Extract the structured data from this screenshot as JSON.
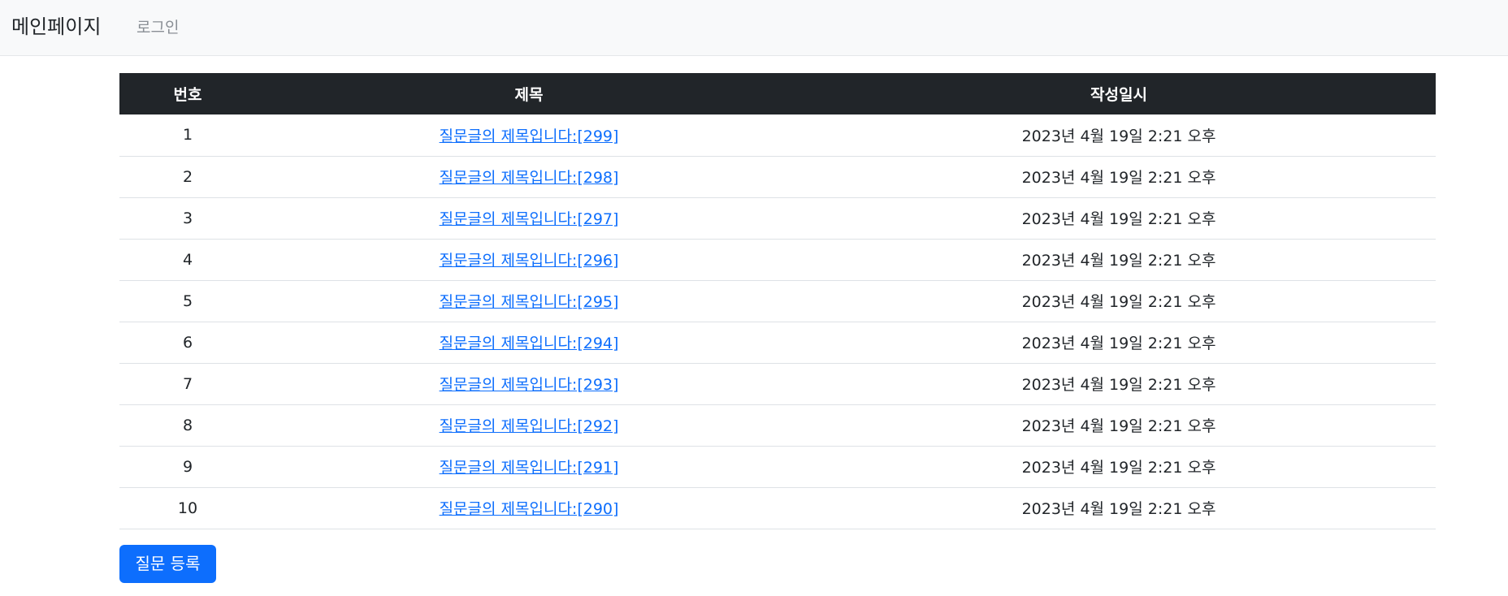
{
  "navbar": {
    "brand": "메인페이지",
    "login_link": "로그인"
  },
  "table": {
    "headers": {
      "number": "번호",
      "title": "제목",
      "created": "작성일시"
    },
    "rows": [
      {
        "number": "1",
        "title": "질문글의 제목입니다:[299]",
        "created": "2023년 4월 19일 2:21 오후"
      },
      {
        "number": "2",
        "title": "질문글의 제목입니다:[298]",
        "created": "2023년 4월 19일 2:21 오후"
      },
      {
        "number": "3",
        "title": "질문글의 제목입니다:[297]",
        "created": "2023년 4월 19일 2:21 오후"
      },
      {
        "number": "4",
        "title": "질문글의 제목입니다:[296]",
        "created": "2023년 4월 19일 2:21 오후"
      },
      {
        "number": "5",
        "title": "질문글의 제목입니다:[295]",
        "created": "2023년 4월 19일 2:21 오후"
      },
      {
        "number": "6",
        "title": "질문글의 제목입니다:[294]",
        "created": "2023년 4월 19일 2:21 오후"
      },
      {
        "number": "7",
        "title": "질문글의 제목입니다:[293]",
        "created": "2023년 4월 19일 2:21 오후"
      },
      {
        "number": "8",
        "title": "질문글의 제목입니다:[292]",
        "created": "2023년 4월 19일 2:21 오후"
      },
      {
        "number": "9",
        "title": "질문글의 제목입니다:[291]",
        "created": "2023년 4월 19일 2:21 오후"
      },
      {
        "number": "10",
        "title": "질문글의 제목입니다:[290]",
        "created": "2023년 4월 19일 2:21 오후"
      }
    ]
  },
  "actions": {
    "create_question_label": "질문 등록"
  },
  "colors": {
    "navbar_bg": "#f8f9fa",
    "table_header_bg": "#212529",
    "link": "#0d6efd",
    "primary_button": "#0d6efd"
  }
}
